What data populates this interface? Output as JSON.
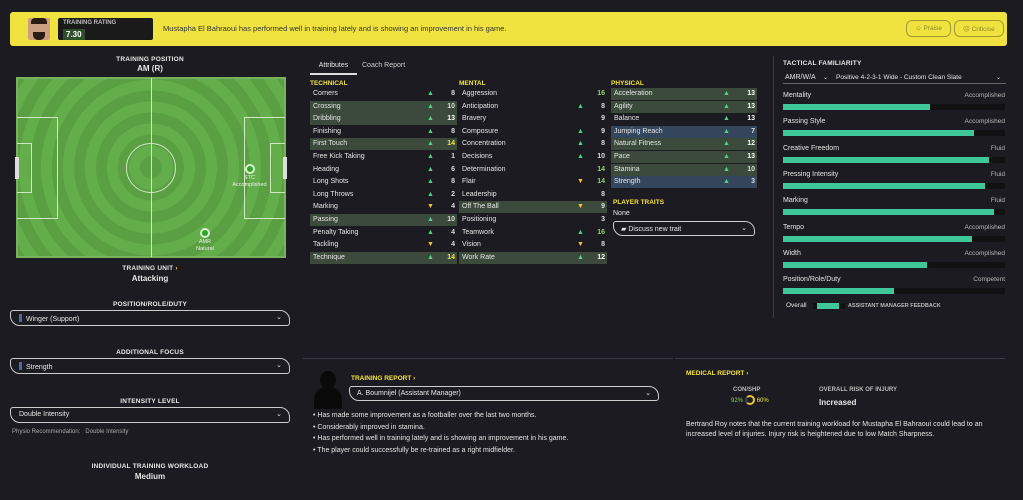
{
  "banner": {
    "rating_label": "TRAINING RATING",
    "rating_value": "7.30",
    "message": "Mustapha El Bahraoui has performed well in training lately and is showing an improvement in his game.",
    "praise_label": "Praise",
    "criticise_label": "Criticise",
    "accent": "#f0e340"
  },
  "left": {
    "training_position_label": "TRAINING POSITION",
    "training_position_value": "AM (R)",
    "players": [
      {
        "role": "STC",
        "note": "Accomplished"
      },
      {
        "role": "AMR",
        "note": "Natural"
      }
    ],
    "training_unit_label": "TRAINING UNIT",
    "training_unit_value": "Attacking",
    "prd_label": "POSITION/ROLE/DUTY",
    "prd_value": "Winger (Support)",
    "additional_focus_label": "ADDITIONAL FOCUS",
    "additional_focus_value": "Strength",
    "intensity_label": "INTENSITY LEVEL",
    "intensity_value": "Double Intensity",
    "physio_label": "Physio Recommendation:",
    "physio_value": "Double Intensity",
    "workload_label": "INDIVIDUAL TRAINING WORKLOAD",
    "workload_value": "Medium"
  },
  "tabs": {
    "attributes": "Attributes",
    "coach_report": "Coach Report"
  },
  "technical": {
    "title": "TECHNICAL",
    "rows": [
      {
        "name": "Corners",
        "value": "8",
        "arrow": "▲"
      },
      {
        "name": "Crossing",
        "value": "10",
        "arrow": "▲"
      },
      {
        "name": "Dribbling",
        "value": "13",
        "arrow": "▲"
      },
      {
        "name": "Finishing",
        "value": "8",
        "arrow": "▲"
      },
      {
        "name": "First Touch",
        "value": "14",
        "arrow": "▲"
      },
      {
        "name": "Free Kick Taking",
        "value": "1",
        "arrow": "▲"
      },
      {
        "name": "Heading",
        "value": "6",
        "arrow": "▲"
      },
      {
        "name": "Long Shots",
        "value": "8",
        "arrow": "▲"
      },
      {
        "name": "Long Throws",
        "value": "2",
        "arrow": "▲"
      },
      {
        "name": "Marking",
        "value": "4",
        "arrow": "▼"
      },
      {
        "name": "Passing",
        "value": "10",
        "arrow": "▲"
      },
      {
        "name": "Penalty Taking",
        "value": "4",
        "arrow": "▲"
      },
      {
        "name": "Tackling",
        "value": "4",
        "arrow": "▼"
      },
      {
        "name": "Technique",
        "value": "14",
        "arrow": "▲"
      }
    ]
  },
  "mental": {
    "title": "MENTAL",
    "rows": [
      {
        "name": "Aggression",
        "value": "16",
        "arrow": ""
      },
      {
        "name": "Anticipation",
        "value": "8",
        "arrow": "▲"
      },
      {
        "name": "Bravery",
        "value": "9",
        "arrow": ""
      },
      {
        "name": "Composure",
        "value": "9",
        "arrow": "▲"
      },
      {
        "name": "Concentration",
        "value": "8",
        "arrow": "▲"
      },
      {
        "name": "Decisions",
        "value": "10",
        "arrow": "▲"
      },
      {
        "name": "Determination",
        "value": "14",
        "arrow": ""
      },
      {
        "name": "Flair",
        "value": "14",
        "arrow": "▼"
      },
      {
        "name": "Leadership",
        "value": "8",
        "arrow": ""
      },
      {
        "name": "Off The Ball",
        "value": "9",
        "arrow": "▼"
      },
      {
        "name": "Positioning",
        "value": "3",
        "arrow": ""
      },
      {
        "name": "Teamwork",
        "value": "16",
        "arrow": "▲"
      },
      {
        "name": "Vision",
        "value": "8",
        "arrow": "▼"
      },
      {
        "name": "Work Rate",
        "value": "12",
        "arrow": "▲"
      }
    ]
  },
  "physical": {
    "title": "PHYSICAL",
    "rows": [
      {
        "name": "Acceleration",
        "value": "13",
        "arrow": "▲"
      },
      {
        "name": "Agility",
        "value": "13",
        "arrow": "▲"
      },
      {
        "name": "Balance",
        "value": "13",
        "arrow": "▲"
      },
      {
        "name": "Jumping Reach",
        "value": "7",
        "arrow": "▲"
      },
      {
        "name": "Natural Fitness",
        "value": "12",
        "arrow": "▲"
      },
      {
        "name": "Pace",
        "value": "13",
        "arrow": "▲"
      },
      {
        "name": "Stamina",
        "value": "10",
        "arrow": "▲"
      },
      {
        "name": "Strength",
        "value": "3",
        "arrow": "▲"
      }
    ]
  },
  "traits": {
    "title": "PLAYER TRAITS",
    "value": "None",
    "discuss_label": "Discuss new trait"
  },
  "tactical": {
    "title": "TACTICAL FAMILIARITY",
    "role_select": "AMR/W/A",
    "tactic_select": "Positive 4-2-3-1 Wide - Custom Clean Slate",
    "items": [
      {
        "name": "Mentality",
        "level": "Accomplished",
        "fill": 0.66
      },
      {
        "name": "Passing Style",
        "level": "Accomplished",
        "fill": 0.86
      },
      {
        "name": "Creative Freedom",
        "level": "Fluid",
        "fill": 0.93
      },
      {
        "name": "Pressing Intensity",
        "level": "Fluid",
        "fill": 0.91
      },
      {
        "name": "Marking",
        "level": "Fluid",
        "fill": 0.95
      },
      {
        "name": "Tempo",
        "level": "Accomplished",
        "fill": 0.85
      },
      {
        "name": "Width",
        "level": "Accomplished",
        "fill": 0.65
      },
      {
        "name": "Position/Role/Duty",
        "level": "Competent",
        "fill": 0.5
      }
    ],
    "overall_label": "Overall",
    "feedback_label": "ASSISTANT MANAGER FEEDBACK"
  },
  "training_report": {
    "title": "TRAINING REPORT",
    "coach": "A. Boumnijel (Assistant Manager)",
    "bullets": [
      "Has made some improvement as a footballer over the last two months.",
      "Considerably improved in stamina.",
      "Has performed well in training lately and is showing an improvement in his game.",
      "The player could successfully be re-trained as a right midfielder."
    ]
  },
  "medical": {
    "title": "MEDICAL REPORT",
    "con_shp_label": "CON/SHP",
    "condition": "92%",
    "sharpness": "60%",
    "risk_label": "OVERALL RISK OF INJURY",
    "risk_value": "Increased",
    "note": "Bertrand Roy notes that the current training workload for Mustapha El Bahraoui could lead to an increased level of injuries. Injury risk is heightened due to low Match Sharpness."
  }
}
